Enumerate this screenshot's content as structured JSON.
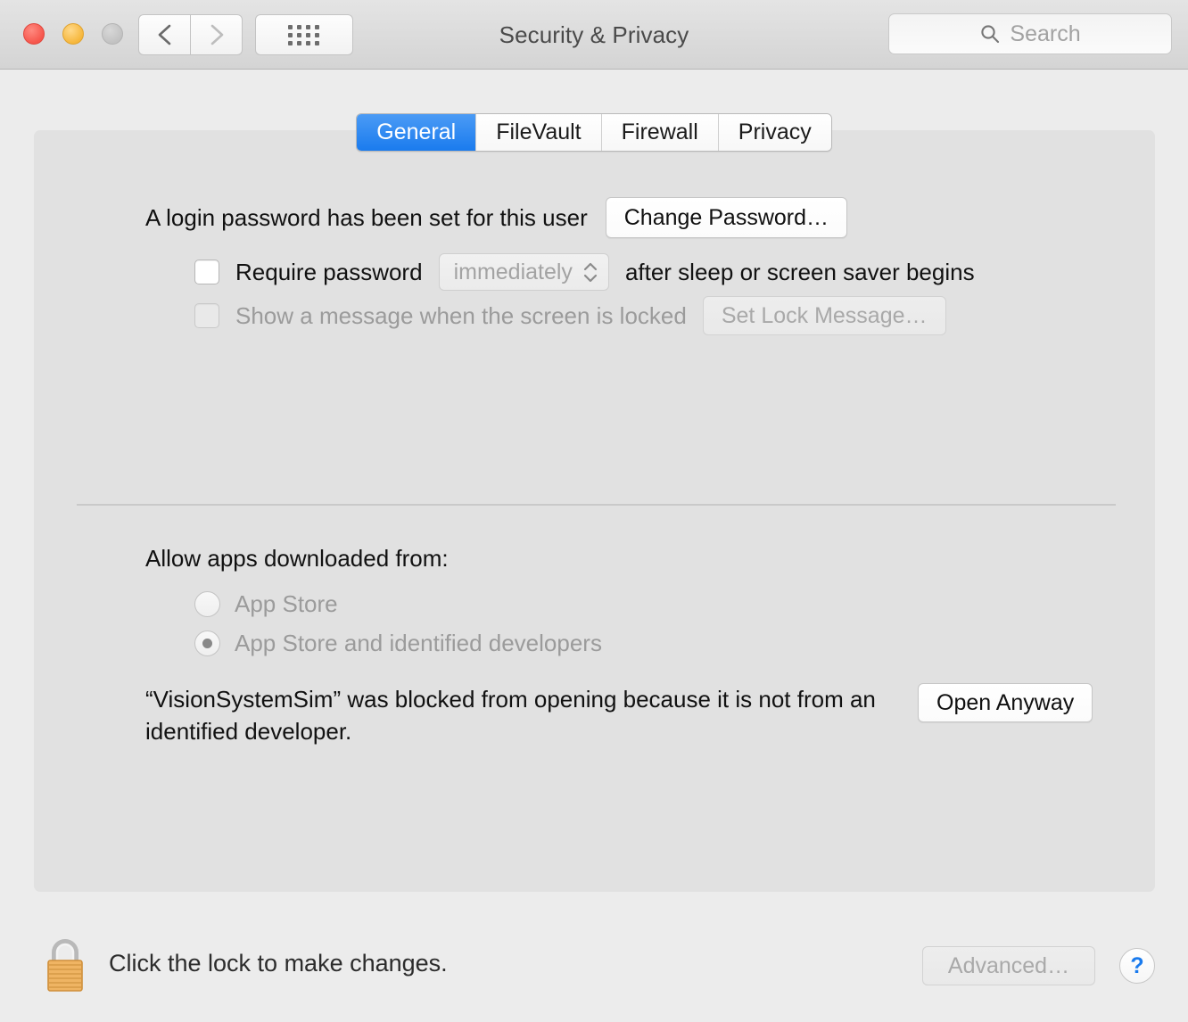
{
  "titlebar": {
    "title": "Security & Privacy",
    "search": {
      "placeholder": "Search",
      "icon": "search-icon"
    },
    "back_icon": "chevron-left-icon",
    "forward_icon": "chevron-right-icon",
    "grid_icon": "show-all-grid-icon",
    "traffic_lights": [
      "close-red",
      "minimize-yellow",
      "zoom-gray-disabled"
    ]
  },
  "tabs": [
    {
      "label": "General",
      "active": true
    },
    {
      "label": "FileVault",
      "active": false
    },
    {
      "label": "Firewall",
      "active": false
    },
    {
      "label": "Privacy",
      "active": false
    }
  ],
  "general": {
    "password_status": "A login password has been set for this user",
    "change_password_button": "Change Password…",
    "require_password": {
      "checked": false,
      "label": "Require password",
      "delay_value": "immediately",
      "suffix": "after sleep or screen saver begins"
    },
    "lock_message": {
      "checked": false,
      "label": "Show a message when the screen is locked",
      "button": "Set Lock Message…",
      "disabled": true
    },
    "allow_apps_heading": "Allow apps downloaded from:",
    "allow_apps_options": [
      {
        "label": "App Store",
        "selected": false,
        "disabled": true
      },
      {
        "label": "App Store and identified developers",
        "selected": true,
        "disabled": true
      }
    ],
    "blocked_message": "“VisionSystemSim” was blocked from opening because it is not from an identified developer.",
    "open_anyway_button": "Open Anyway"
  },
  "bottom": {
    "lock_icon": "padlock-closed-icon",
    "lock_text": "Click the lock to make changes.",
    "advanced_button": "Advanced…",
    "help_button": "?"
  },
  "colors": {
    "accent_blue": "#1a7bee",
    "window_bg": "#ececec",
    "panel_bg": "#e1e1e1",
    "disabled_text": "#a9a9a9"
  }
}
